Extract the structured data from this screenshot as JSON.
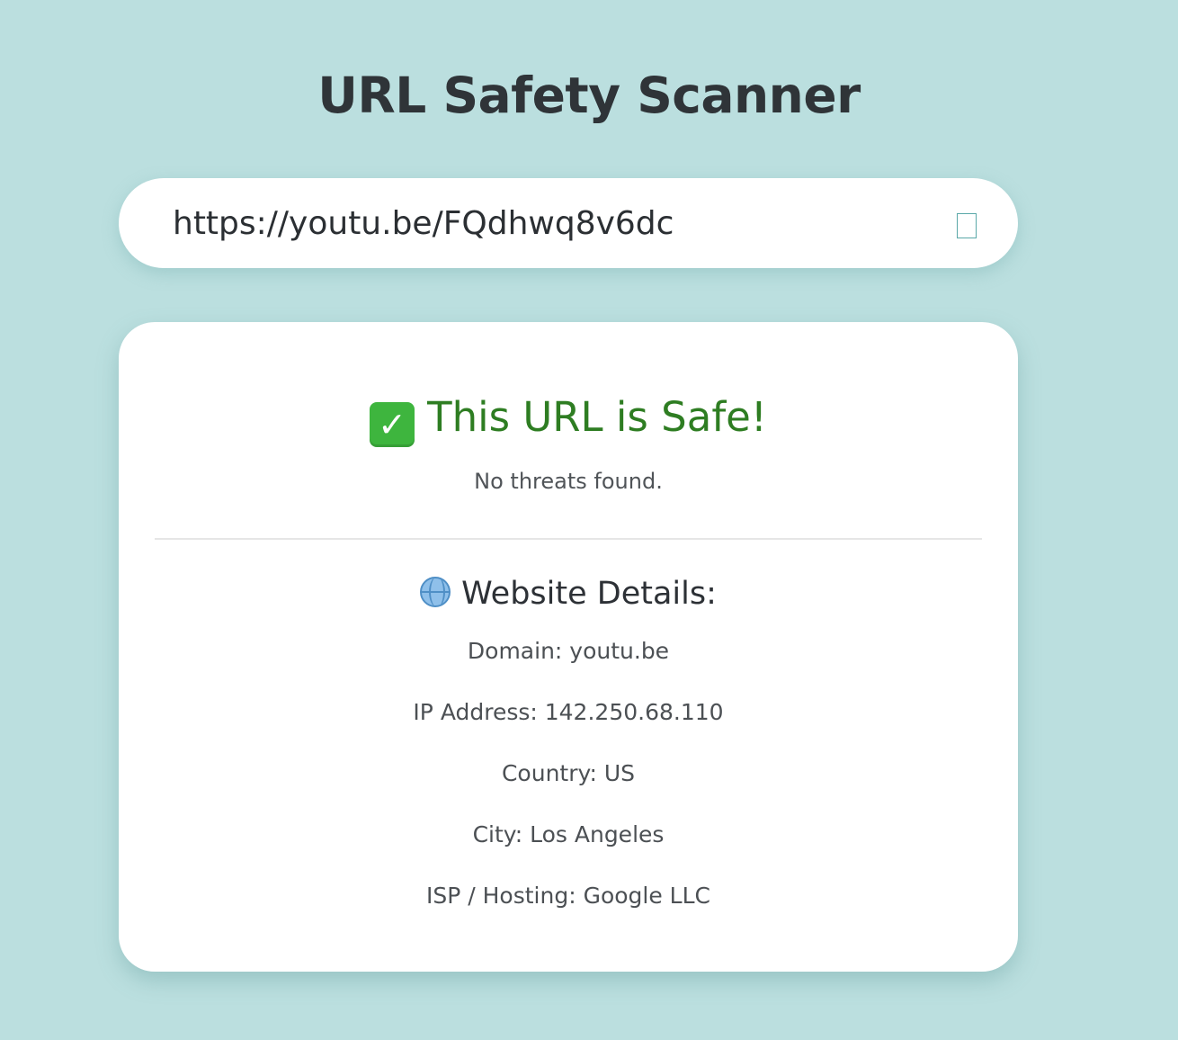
{
  "header": {
    "title": "URL Safety Scanner"
  },
  "search": {
    "value": "https://youtu.be/FQdhwq8v6dc",
    "button_icon": "empty-box-icon"
  },
  "result": {
    "status_icon": "check-mark-icon",
    "status_icon_color": "#3eb53e",
    "status_title": "This URL is Safe!",
    "status_color": "#2e7d22",
    "status_subtitle": "No threats found."
  },
  "details": {
    "icon": "globe-icon",
    "heading": "Website Details:",
    "rows": [
      "Domain: youtu.be",
      "IP Address: 142.250.68.110",
      "Country: US",
      "City: Los Angeles",
      "ISP / Hosting: Google LLC"
    ]
  },
  "colors": {
    "background": "#bbdfdf",
    "card": "#ffffff",
    "title_text": "#2f3438"
  }
}
